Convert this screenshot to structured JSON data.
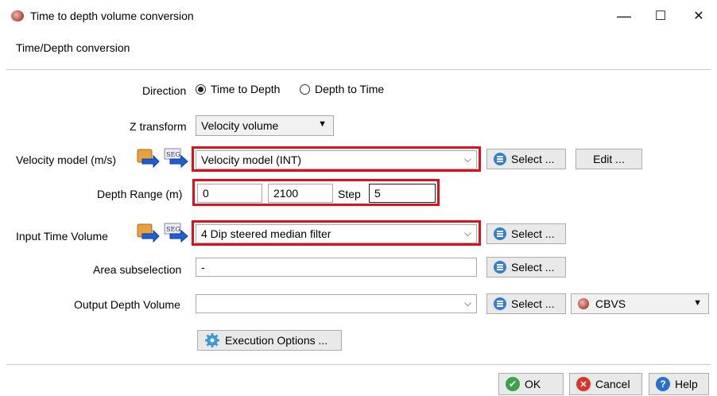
{
  "window": {
    "title": "Time to depth volume conversion",
    "minimize_glyph": "—",
    "maximize_glyph": "☐",
    "close_glyph": "✕"
  },
  "section_title": "Time/Depth conversion",
  "direction": {
    "label": "Direction",
    "options": [
      "Time to Depth",
      "Depth to Time"
    ],
    "selected": "Time to Depth"
  },
  "z_transform": {
    "label": "Z transform",
    "value": "Velocity volume"
  },
  "velocity_model": {
    "label": "Velocity model (m/s)",
    "value": "Velocity model (INT)",
    "select_label": "Select ...",
    "edit_label": "Edit ..."
  },
  "depth_range": {
    "label": "Depth Range (m)",
    "start": "0",
    "stop": "2100",
    "step_label": "Step",
    "step": "5"
  },
  "input_time_volume": {
    "label": "Input Time Volume",
    "value": "4 Dip steered median filter",
    "select_label": "Select ..."
  },
  "area_subselection": {
    "label": "Area subselection",
    "value": "-",
    "select_label": "Select ..."
  },
  "output_depth_volume": {
    "label": "Output Depth Volume",
    "value": "",
    "select_label": "Select ...",
    "format": "CBVS"
  },
  "execution_options_label": "Execution Options ...",
  "footer": {
    "ok_label": "OK",
    "cancel_label": "Cancel",
    "help_label": "Help"
  },
  "colors": {
    "highlight_red": "#e0101a",
    "select_icon_blue": "#2f7fd6",
    "ok_green": "#3aa34a",
    "cancel_red": "#d9362b",
    "help_blue": "#2a6fc9"
  }
}
